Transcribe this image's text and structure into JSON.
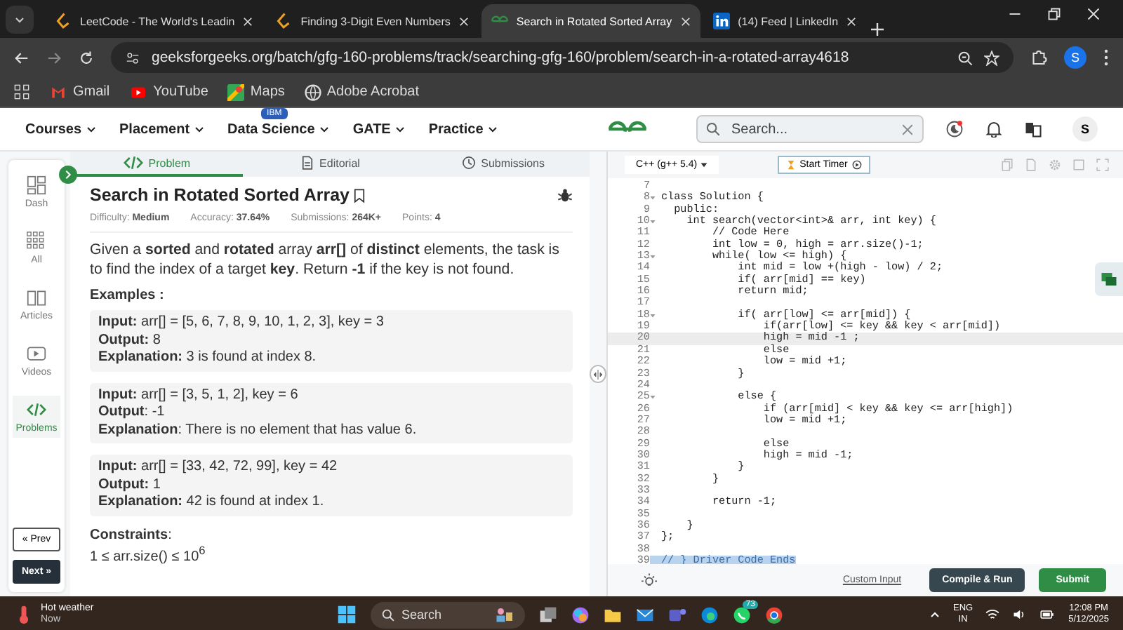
{
  "browser": {
    "tabs": [
      {
        "title": "LeetCode - The World's Leadin",
        "selected": false
      },
      {
        "title": "Finding 3-Digit Even Numbers",
        "selected": false
      },
      {
        "title": "Search in Rotated Sorted Array",
        "selected": true
      },
      {
        "title": "(14) Feed | LinkedIn",
        "selected": false
      }
    ],
    "url": "geeksforgeeks.org/batch/gfg-160-problems/track/searching-gfg-160/problem/search-in-a-rotated-array4618",
    "profile": "S",
    "bookmarks": [
      {
        "label": "Gmail"
      },
      {
        "label": "YouTube"
      },
      {
        "label": "Maps"
      },
      {
        "label": "Adobe Acrobat"
      }
    ]
  },
  "site_nav": {
    "items": [
      {
        "label": "Courses"
      },
      {
        "label": "Placement"
      },
      {
        "label": "Data Science",
        "badge": "IBM"
      },
      {
        "label": "GATE"
      },
      {
        "label": "Practice"
      }
    ],
    "search": {
      "placeholder": "Search..."
    },
    "avatar": "S"
  },
  "rail": {
    "items": [
      {
        "label": "Dash",
        "selected": false
      },
      {
        "label": "All",
        "selected": false
      },
      {
        "label": "Articles",
        "selected": false
      },
      {
        "label": "Videos",
        "selected": false
      },
      {
        "label": "Problems",
        "selected": true
      }
    ],
    "prev": "« Prev",
    "next": "Next »"
  },
  "problem": {
    "tabs": [
      {
        "label": "Problem",
        "selected": true
      },
      {
        "label": "Editorial",
        "selected": false
      },
      {
        "label": "Submissions",
        "selected": false
      }
    ],
    "title": "Search in Rotated Sorted Array",
    "meta": [
      "Difficulty: **Medium**",
      "Accuracy: **37.64%**",
      "Submissions: **264K+**",
      "Points: **4**"
    ],
    "description": "Given a **sorted** and **rotated** array **arr[]** of **distinct** elements, the task is to find the index of a target **key**. Return **-1** if the key is not found.",
    "examples_heading": "Examples :",
    "examples": [
      [
        "**Input:** arr[] = [5, 6, 7, 8, 9, 10, 1, 2, 3], key = 3",
        "**Output:** 8",
        "**Explanation:** 3 is found at index 8."
      ],
      [
        "**Input:** arr[] = [3, 5, 1, 2], key = 6",
        "**Output**: -1",
        "**Explanation**: There is no element that has value 6."
      ],
      [
        "**Input:** arr[] = [33, 42, 72, 99], key = 42",
        "**Output:** 1",
        "**Explanation:** 42 is found at index 1."
      ]
    ],
    "constraints_heading": "**Constraints**:",
    "constraint": "1 ≤ arr.size() ≤ 10$^{6}$"
  },
  "editor": {
    "language": "C++ (g++ 5.4)",
    "timer": "Start Timer",
    "lines": [
      {
        "n": "7",
        "fold": false,
        "active": false,
        "selected": false
      },
      {
        "n": "8",
        "text": "class Solution {",
        "fold": true,
        "active": false,
        "selected": false
      },
      {
        "n": "9",
        "text": "  public:",
        "fold": false,
        "active": false,
        "selected": false
      },
      {
        "n": "10",
        "text": "    int search(vector<int>& arr, int key) {",
        "fold": true,
        "active": false,
        "selected": false
      },
      {
        "n": "11",
        "text": "        // Code Here",
        "fold": false,
        "active": false,
        "selected": false
      },
      {
        "n": "12",
        "text": "        int low = 0, high = arr.size()-1;",
        "fold": false,
        "active": false,
        "selected": false
      },
      {
        "n": "13",
        "text": "        while( low <= high) {",
        "fold": true,
        "active": false,
        "selected": false
      },
      {
        "n": "14",
        "text": "            int mid = low +(high - low) / 2;",
        "fold": false,
        "active": false,
        "selected": false
      },
      {
        "n": "15",
        "text": "            if( arr[mid] == key)",
        "fold": false,
        "active": false,
        "selected": false
      },
      {
        "n": "16",
        "text": "            return mid;",
        "fold": false,
        "active": false,
        "selected": false
      },
      {
        "n": "17",
        "fold": false,
        "active": false,
        "selected": false
      },
      {
        "n": "18",
        "text": "            if( arr[low] <= arr[mid]) {",
        "fold": true,
        "active": false,
        "selected": false
      },
      {
        "n": "19",
        "text": "                if(arr[low] <= key && key < arr[mid])",
        "fold": false,
        "active": false,
        "selected": false
      },
      {
        "n": "20",
        "text": "                high = mid -1 ;",
        "fold": false,
        "active": true,
        "selected": false
      },
      {
        "n": "21",
        "text": "                else",
        "fold": false,
        "active": false,
        "selected": false
      },
      {
        "n": "22",
        "text": "                low = mid +1;",
        "fold": false,
        "active": false,
        "selected": false
      },
      {
        "n": "23",
        "text": "            }",
        "fold": false,
        "active": false,
        "selected": false
      },
      {
        "n": "24",
        "fold": false,
        "active": false,
        "selected": false
      },
      {
        "n": "25",
        "text": "            else {",
        "fold": true,
        "active": false,
        "selected": false
      },
      {
        "n": "26",
        "text": "                if (arr[mid] < key && key <= arr[high])",
        "fold": false,
        "active": false,
        "selected": false
      },
      {
        "n": "27",
        "text": "                low = mid +1;",
        "fold": false,
        "active": false,
        "selected": false
      },
      {
        "n": "28",
        "fold": false,
        "active": false,
        "selected": false
      },
      {
        "n": "29",
        "text": "                else",
        "fold": false,
        "active": false,
        "selected": false
      },
      {
        "n": "30",
        "text": "                high = mid -1;",
        "fold": false,
        "active": false,
        "selected": false
      },
      {
        "n": "31",
        "text": "            }",
        "fold": false,
        "active": false,
        "selected": false
      },
      {
        "n": "32",
        "text": "        }",
        "fold": false,
        "active": false,
        "selected": false
      },
      {
        "n": "33",
        "fold": false,
        "active": false,
        "selected": false
      },
      {
        "n": "34",
        "text": "        return -1;",
        "fold": false,
        "active": false,
        "selected": false
      },
      {
        "n": "35",
        "fold": false,
        "active": false,
        "selected": false
      },
      {
        "n": "36",
        "text": "    }",
        "fold": false,
        "active": false,
        "selected": false
      },
      {
        "n": "37",
        "text": "};",
        "fold": false,
        "active": false,
        "selected": false
      },
      {
        "n": "38",
        "fold": false,
        "active": false,
        "selected": false
      },
      {
        "n": "39",
        "text": "// } Driver Code Ends",
        "fold": false,
        "active": false,
        "selected": true
      }
    ],
    "custom_input": "Custom Input",
    "compile": "Compile & Run",
    "submit": "Submit"
  },
  "taskbar": {
    "weather": "Hot weather",
    "weather_sub": "Now",
    "search": "Search",
    "whatsapp_badge": "73",
    "lang": "ENG",
    "region": "IN",
    "time": "12:08 PM",
    "date": "5/12/2025"
  }
}
